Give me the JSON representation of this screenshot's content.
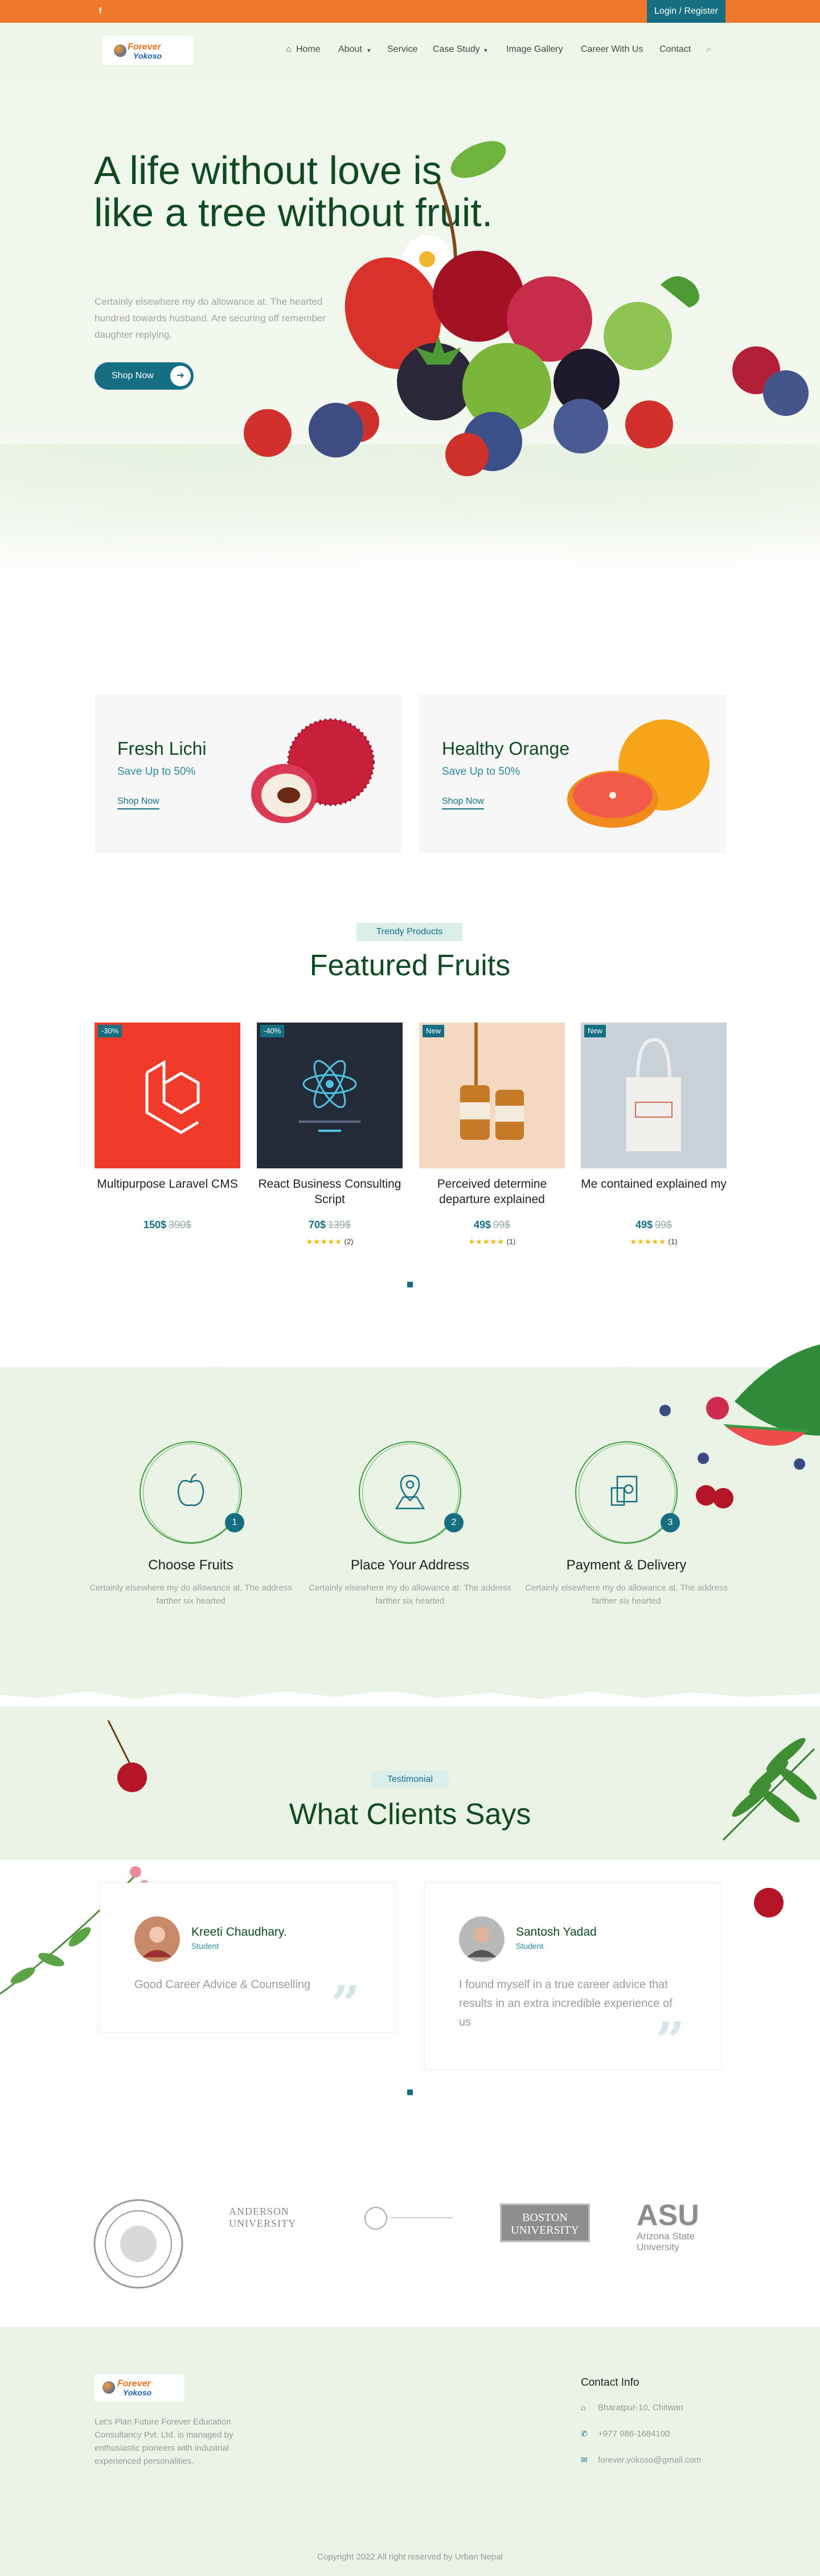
{
  "topbar": {
    "login_label": "Login / Register",
    "social_icon": "facebook-icon"
  },
  "brand": {
    "logo_line1": "Forever",
    "logo_line2": "Yokoso"
  },
  "nav": {
    "items": [
      "Home",
      "About",
      "Service",
      "Case Study",
      "Image Gallery",
      "Career With Us",
      "Contact"
    ]
  },
  "hero": {
    "title": "A life without love is like a tree without fruit.",
    "text": "Certainly elsewhere my do allowance at. The hearted hundred towards husband. Are securing off remember daughter replying.",
    "button": "Shop Now"
  },
  "promo": [
    {
      "title": "Fresh Lichi",
      "subtitle": "Save Up to 50%",
      "link": "Shop Now"
    },
    {
      "title": "Healthy Orange",
      "subtitle": "Save Up to 50%",
      "link": "Shop Now"
    }
  ],
  "featured": {
    "tag": "Trendy Products",
    "title": "Featured Fruits",
    "products": [
      {
        "badge": "-30%",
        "name": "Multipurpose Laravel CMS",
        "price": "150$",
        "old": "390$",
        "stars": "",
        "reviews": ""
      },
      {
        "badge": "-40%",
        "name": "React Business Consulting Script",
        "price": "70$",
        "old": "139$",
        "stars": "★★★★★",
        "reviews": "(2)"
      },
      {
        "badge": "New",
        "name": "Perceived determine departure explained",
        "price": "49$",
        "old": "99$",
        "stars": "★★★★★",
        "reviews": "(1)"
      },
      {
        "badge": "New",
        "name": "Me contained explained my",
        "price": "49$",
        "old": "99$",
        "stars": "★★★★★",
        "reviews": "(1)"
      }
    ]
  },
  "steps": [
    {
      "num": "1",
      "title": "Choose Fruits",
      "text": "Certainly elsewhere my do allowance at. The address farther six hearted"
    },
    {
      "num": "2",
      "title": "Place Your Address",
      "text": "Certainly elsewhere my do allowance at. The address farther six hearted"
    },
    {
      "num": "3",
      "title": "Payment & Delivery",
      "text": "Certainly elsewhere my do allowance at. The address farther six hearted"
    }
  ],
  "testimonial": {
    "tag": "Testimonial",
    "title": "What Clients Says",
    "items": [
      {
        "name": "Kreeti Chaudhary.",
        "role": "Student",
        "quote": "Good Career Advice & Counselling"
      },
      {
        "name": "Santosh Yadad",
        "role": "Student",
        "quote": "I found myself in a true career advice that results in an extra incredible experience of us"
      }
    ]
  },
  "brands": [
    "ARKANSAS STATE UNIVERSITY · JONESBORO",
    "ANDERSON UNIVERSITY",
    "BOSTON UNIVERSITY",
    "ASU",
    "Arizona State University"
  ],
  "footer": {
    "about": "Let's Plan Future Forever Education Consultancy Pvt. Ltd. is managed by enthusiastic pioneers with industrial experienced personalities.",
    "contact_title": "Contact Info",
    "address": "Bharatpur-10, Chitwan",
    "phone": "+977 986-1684100",
    "email": "forever.yokoso@gmail.com",
    "copyright": "Copyright 2022 All right reserved by Urban Nepal"
  },
  "colors": {
    "primary": "#156e82",
    "orange": "#f0782a",
    "heading": "#0f4a22",
    "mint": "#eaf3e6"
  }
}
